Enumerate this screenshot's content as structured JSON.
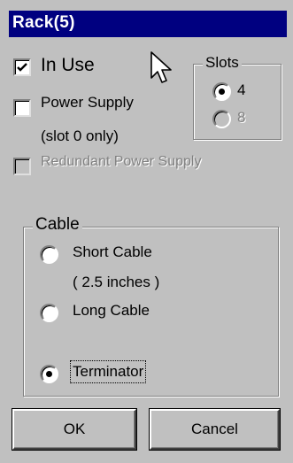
{
  "window": {
    "title": "Rack(5)"
  },
  "options": {
    "in_use": {
      "label": "In Use",
      "checked": true
    },
    "power_supply": {
      "label": "Power Supply",
      "note": "(slot 0 only)",
      "checked": false
    },
    "redundant": {
      "label": "Redundant Power Supply",
      "checked": false,
      "disabled": true
    }
  },
  "slots": {
    "title": "Slots",
    "options": [
      {
        "label": "4",
        "selected": true
      },
      {
        "label": "8",
        "selected": false,
        "disabled": true
      }
    ]
  },
  "cable": {
    "title": "Cable",
    "options": [
      {
        "label": "Short Cable",
        "note": "( 2.5 inches )",
        "selected": false
      },
      {
        "label": "Long Cable",
        "selected": false
      },
      {
        "label": "Terminator",
        "selected": true
      }
    ]
  },
  "buttons": {
    "ok": "OK",
    "cancel": "Cancel"
  },
  "colors": {
    "titlebar": "#000080",
    "face": "#c0c0c0",
    "disabled_text": "#808080"
  }
}
